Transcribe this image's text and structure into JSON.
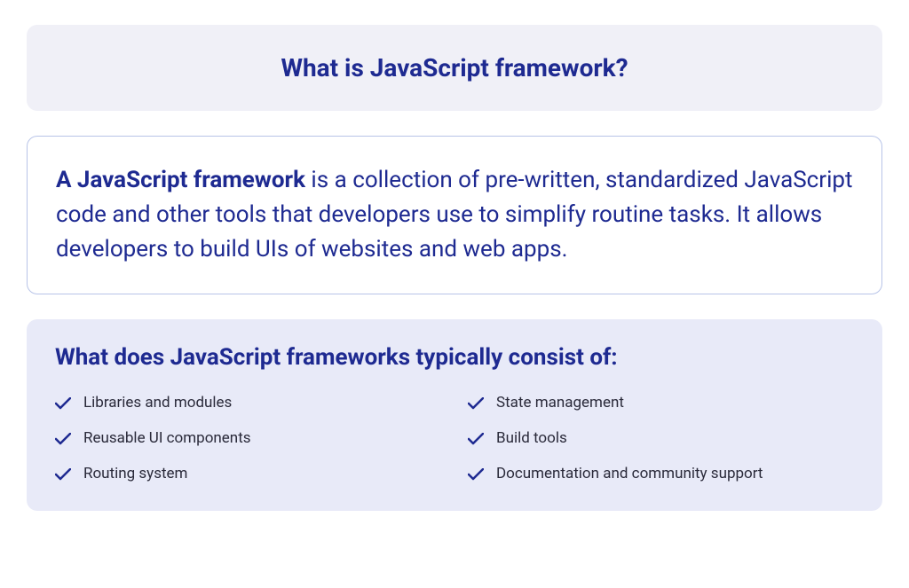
{
  "header": {
    "title": "What is JavaScript framework?"
  },
  "definition": {
    "bold": "A JavaScript framework",
    "text": " is a collection of pre-written, standardized JavaScript code and other tools that developers use to simplify routine tasks. It allows developers to build UIs of websites and web apps."
  },
  "components": {
    "title": "What does JavaScript frameworks typically consist of:",
    "items_left": [
      "Libraries and modules",
      "Reusable UI components",
      "Routing system"
    ],
    "items_right": [
      "State management",
      "Build tools",
      "Documentation and community support"
    ]
  },
  "colors": {
    "primary": "#1e2a91",
    "header_bg": "#f0f0f7",
    "components_bg": "#e8eaf8",
    "border": "#b8c4e8",
    "text_dark": "#2a2a3a"
  }
}
